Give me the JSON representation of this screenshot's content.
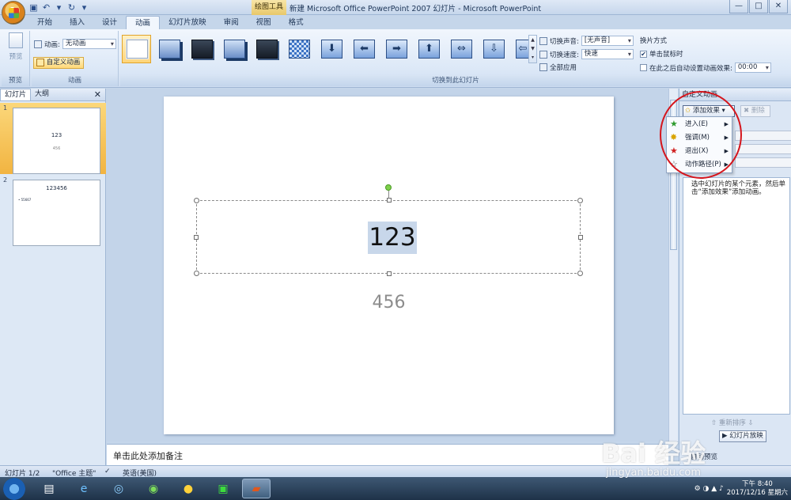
{
  "window": {
    "title": "新建 Microsoft Office PowerPoint 2007 幻灯片 - Microsoft PowerPoint",
    "tool_context": "绘图工具",
    "controls": [
      "—",
      "□",
      "✕"
    ]
  },
  "tabs": [
    {
      "label": "开始",
      "active": false
    },
    {
      "label": "插入",
      "active": false
    },
    {
      "label": "设计",
      "active": false
    },
    {
      "label": "动画",
      "active": true
    },
    {
      "label": "幻灯片放映",
      "active": false
    },
    {
      "label": "审阅",
      "active": false
    },
    {
      "label": "视图",
      "active": false
    },
    {
      "label": "格式",
      "active": false
    }
  ],
  "ribbon": {
    "preview": {
      "button": "预览",
      "group": "预览"
    },
    "animation": {
      "label": "动画:",
      "value": "无动画",
      "custom_button": "自定义动画",
      "group": "动画"
    },
    "transition": {
      "group": "切换到此幻灯片",
      "sound_label": "切换声音:",
      "sound_value": "[无声音]",
      "speed_label": "切换速度:",
      "speed_value": "快速",
      "apply_all": "全部应用",
      "advance_title": "换片方式",
      "on_click": "单击鼠标时",
      "on_click_checked": true,
      "auto_after": "在此之后自动设置动画效果:",
      "auto_after_checked": false,
      "auto_time": "00:00"
    }
  },
  "left_panel": {
    "tabs": [
      "幻灯片",
      "大纲"
    ],
    "close": "✕",
    "slides": [
      {
        "number": "1",
        "title": "123",
        "subtitle": "456",
        "selected": true
      },
      {
        "number": "2",
        "title": "123456",
        "bullet": "• 55667",
        "selected": false
      }
    ]
  },
  "slide": {
    "title": "123",
    "subtitle": "456"
  },
  "notes": {
    "placeholder": "单击此处添加备注"
  },
  "task_pane": {
    "title": "自定义动画",
    "add_effect": "添加效果",
    "delete": "删除",
    "hint": "选中幻灯片的某个元素，然后单击“添加效果”添加动画。",
    "reorder": "重新排序",
    "play": "幻灯片放映",
    "autopreview": "自动预览",
    "menu": [
      {
        "label": "进入(E)",
        "icon": "green-star-icon",
        "color": "#2e9b2e"
      },
      {
        "label": "强调(M)",
        "icon": "yellow-star-icon",
        "color": "#d9a400"
      },
      {
        "label": "退出(X)",
        "icon": "red-star-icon",
        "color": "#d02020"
      },
      {
        "label": "动作路径(P)",
        "icon": "outline-star-icon",
        "color": "#ffffff"
      }
    ]
  },
  "statusbar": {
    "slide": "幻灯片 1/2",
    "theme": "\"Office 主题\"",
    "language": "英语(美国)"
  },
  "taskbar": {
    "time": "下午 8:40",
    "date": "2017/12/16 星期六"
  },
  "watermark": {
    "logo": "Bai 经验",
    "url": "jingyan.baidu.com"
  },
  "colors": {
    "ribbon": "#dce8f7",
    "selected": "#f2b441",
    "annotation": "#d5151c"
  }
}
